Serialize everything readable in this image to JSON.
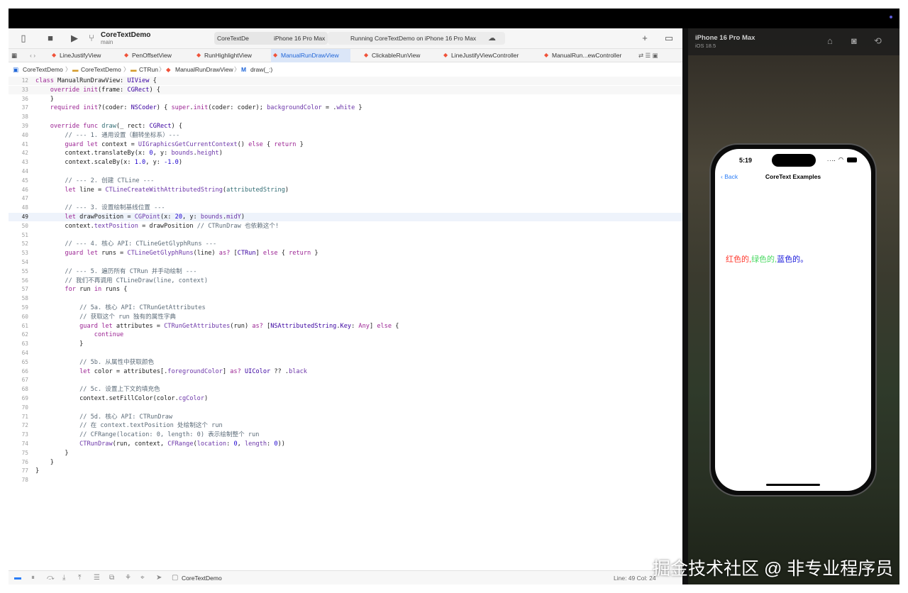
{
  "toolbar": {
    "project_name": "CoreTextDemo",
    "branch": "main",
    "scheme_target": "CoreTextDe",
    "scheme_device": "iPhone 16 Pro Max",
    "run_status": "Running CoreTextDemo on iPhone 16 Pro Max"
  },
  "tabs": [
    {
      "label": "LineJustifyView",
      "active": false
    },
    {
      "label": "PenOffsetView",
      "active": false
    },
    {
      "label": "RunHighlightView",
      "active": false
    },
    {
      "label": "ManualRunDrawView",
      "active": true
    },
    {
      "label": "ClickableRunView",
      "active": false
    },
    {
      "label": "LineJustifyViewController",
      "active": false
    },
    {
      "label": "ManualRun...ewController",
      "active": false
    }
  ],
  "jumpbar": [
    "CoreTextDemo",
    "CoreTextDemo",
    "CTRun",
    "ManualRunDrawView",
    "draw(_:)"
  ],
  "editor": {
    "current_line": "49",
    "lines": [
      {
        "n": "12",
        "html": "<span class=\"k\">class</span> ManualRunDrawView: <span class=\"t\">UIView</span> {"
      },
      {
        "n": "33",
        "html": "    <span class=\"k\">override</span> <span class=\"k\">init</span>(frame: <span class=\"t\">CGRect</span>) {"
      },
      {
        "n": "36",
        "html": "    }"
      },
      {
        "n": "37",
        "html": "    <span class=\"k\">required</span> <span class=\"k\">init</span>?(coder: <span class=\"t\">NSCoder</span>) { <span class=\"k\">super</span>.<span class=\"k\">init</span>(coder: coder); <span class=\"p\">backgroundColor</span> = .<span class=\"p\">white</span> }"
      },
      {
        "n": "38",
        "html": ""
      },
      {
        "n": "39",
        "html": "    <span class=\"k\">override</span> <span class=\"k\">func</span> <span class=\"f\">draw</span>(_ rect: <span class=\"t\">CGRect</span>) {"
      },
      {
        "n": "40",
        "html": "        <span class=\"c\">// --- 1. 通用设置（翻转坐标系）---</span>"
      },
      {
        "n": "41",
        "html": "        <span class=\"k\">guard</span> <span class=\"k\">let</span> context = <span class=\"p\">UIGraphicsGetCurrentContext</span>() <span class=\"k\">else</span> { <span class=\"k\">return</span> }"
      },
      {
        "n": "42",
        "html": "        context.translateBy(x: <span class=\"n\">0</span>, y: <span class=\"p\">bounds</span>.<span class=\"p\">height</span>)"
      },
      {
        "n": "43",
        "html": "        context.scaleBy(x: <span class=\"n\">1.0</span>, y: <span class=\"n\">-1.0</span>)"
      },
      {
        "n": "44",
        "html": ""
      },
      {
        "n": "45",
        "html": "        <span class=\"c\">// --- 2. 创建 CTLine ---</span>"
      },
      {
        "n": "46",
        "html": "        <span class=\"k\">let</span> line = <span class=\"p\">CTLineCreateWithAttributedString</span>(<span class=\"f\">attributedString</span>)"
      },
      {
        "n": "47",
        "html": ""
      },
      {
        "n": "48",
        "html": "        <span class=\"c\">// --- 3. 设置绘制基线位置 ---</span>"
      },
      {
        "n": "49",
        "html": "        <span class=\"k\">let</span> drawPosition = <span class=\"p\">CGPoint</span>(x: <span class=\"n\">20</span>, y: <span class=\"p\">bounds</span>.<span class=\"p\">midY</span>)"
      },
      {
        "n": "50",
        "html": "        context.<span class=\"p\">textPosition</span> = drawPosition <span class=\"c\">// CTRunDraw 也依赖这个!</span>"
      },
      {
        "n": "51",
        "html": ""
      },
      {
        "n": "52",
        "html": "        <span class=\"c\">// --- 4. 核心 API: CTLineGetGlyphRuns ---</span>"
      },
      {
        "n": "53",
        "html": "        <span class=\"k\">guard</span> <span class=\"k\">let</span> runs = <span class=\"p\">CTLineGetGlyphRuns</span>(line) <span class=\"k\">as?</span> [<span class=\"t\">CTRun</span>] <span class=\"k\">else</span> { <span class=\"k\">return</span> }"
      },
      {
        "n": "54",
        "html": ""
      },
      {
        "n": "55",
        "html": "        <span class=\"c\">// --- 5. 遍历所有 CTRun 并手动绘制 ---</span>"
      },
      {
        "n": "56",
        "html": "        <span class=\"c\">// 我们不再调用 CTLineDraw(line, context)</span>"
      },
      {
        "n": "57",
        "html": "        <span class=\"k\">for</span> run <span class=\"k\">in</span> runs {"
      },
      {
        "n": "58",
        "html": ""
      },
      {
        "n": "59",
        "html": "            <span class=\"c\">// 5a. 核心 API: CTRunGetAttributes</span>"
      },
      {
        "n": "60",
        "html": "            <span class=\"c\">// 获取这个 run 独有的属性字典</span>"
      },
      {
        "n": "61",
        "html": "            <span class=\"k\">guard</span> <span class=\"k\">let</span> attributes = <span class=\"p\">CTRunGetAttributes</span>(run) <span class=\"k\">as?</span> [<span class=\"t\">NSAttributedString</span>.<span class=\"t\">Key</span>: <span class=\"k\">Any</span>] <span class=\"k\">else</span> {"
      },
      {
        "n": "62",
        "html": "                <span class=\"k\">continue</span>"
      },
      {
        "n": "63",
        "html": "            }"
      },
      {
        "n": "64",
        "html": ""
      },
      {
        "n": "65",
        "html": "            <span class=\"c\">// 5b. 从属性中获取颜色</span>"
      },
      {
        "n": "66",
        "html": "            <span class=\"k\">let</span> color = attributes[.<span class=\"p\">foregroundColor</span>] <span class=\"k\">as?</span> <span class=\"t\">UIColor</span> ?? .<span class=\"p\">black</span>"
      },
      {
        "n": "67",
        "html": ""
      },
      {
        "n": "68",
        "html": "            <span class=\"c\">// 5c. 设置上下文的填充色</span>"
      },
      {
        "n": "69",
        "html": "            context.setFillColor(color.<span class=\"p\">cgColor</span>)"
      },
      {
        "n": "70",
        "html": ""
      },
      {
        "n": "71",
        "html": "            <span class=\"c\">// 5d. 核心 API: CTRunDraw</span>"
      },
      {
        "n": "72",
        "html": "            <span class=\"c\">// 在 context.textPosition 处绘制这个 run</span>"
      },
      {
        "n": "73",
        "html": "            <span class=\"c\">// CFRange(location: 0, length: 0) 表示绘制整个 run</span>"
      },
      {
        "n": "74",
        "html": "            <span class=\"p\">CTRunDraw</span>(run, context, <span class=\"p\">CFRange</span>(<span class=\"p\">location</span>: <span class=\"n\">0</span>, <span class=\"p\">length</span>: <span class=\"n\">0</span>))"
      },
      {
        "n": "75",
        "html": "        }"
      },
      {
        "n": "76",
        "html": "    }"
      },
      {
        "n": "77",
        "html": "}"
      },
      {
        "n": "78",
        "html": ""
      }
    ]
  },
  "statusbar": {
    "scheme": "CoreTextDemo",
    "cursor": "Line: 49  Col: 24"
  },
  "simulator": {
    "device_name": "iPhone 16 Pro Max",
    "os": "iOS 18.5",
    "time": "5:19",
    "back_label": "Back",
    "nav_title": "CoreText Examples",
    "segments": [
      {
        "text": "红色的,",
        "color": "#ff3b30"
      },
      {
        "text": "绿色的,",
        "color": "#4cd964"
      },
      {
        "text": "蓝色的。",
        "color": "#1a1adb"
      }
    ]
  },
  "watermark": "掘金技术社区 @ 非专业程序员"
}
